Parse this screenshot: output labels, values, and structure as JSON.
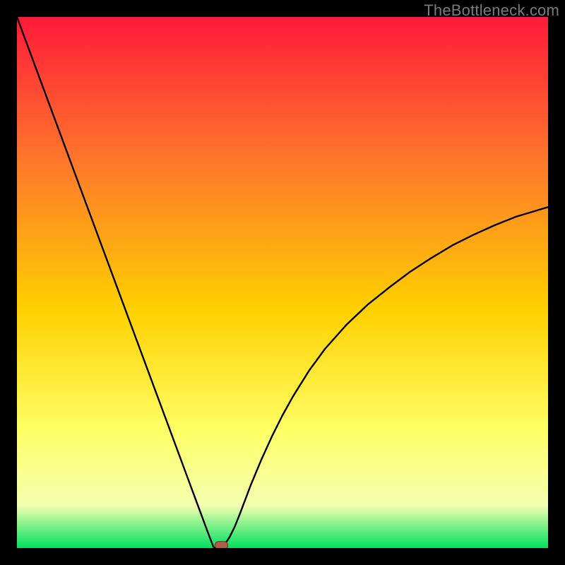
{
  "attribution": "TheBottleneck.com",
  "colors": {
    "background": "#000000",
    "gradient_top": "#ff1a3a",
    "gradient_upper_mid": "#ff7a2a",
    "gradient_mid": "#ffd000",
    "gradient_lower_mid": "#ffff66",
    "gradient_low": "#f3ffb0",
    "gradient_bottom": "#00e060",
    "curve": "#000000",
    "dot_fill": "#b35a4a",
    "dot_stroke": "#6e2f23"
  },
  "chart_data": {
    "type": "line",
    "title": "",
    "xlabel": "",
    "ylabel": "",
    "xlim": [
      0,
      100
    ],
    "ylim": [
      0,
      100
    ],
    "x": [
      0,
      2,
      4,
      6,
      8,
      10,
      12,
      14,
      16,
      18,
      20,
      22,
      24,
      26,
      28,
      30,
      32,
      34,
      36,
      37,
      38,
      39,
      40,
      41,
      42,
      44,
      46,
      48,
      50,
      52,
      55,
      58,
      62,
      66,
      70,
      74,
      78,
      82,
      86,
      90,
      94,
      98,
      100
    ],
    "values": [
      100,
      94.6,
      89.2,
      83.8,
      78.4,
      73.0,
      67.6,
      62.2,
      56.8,
      51.4,
      46.0,
      40.6,
      35.2,
      29.8,
      24.4,
      19.0,
      13.6,
      8.2,
      2.8,
      0.2,
      0.0,
      0.5,
      2.0,
      4.0,
      6.5,
      11.8,
      16.6,
      21.0,
      25.0,
      28.6,
      33.4,
      37.5,
      42.0,
      45.8,
      49.0,
      52.0,
      54.6,
      57.0,
      59.0,
      60.8,
      62.4,
      63.6,
      64.2
    ],
    "marker": {
      "x": 38.5,
      "y": 0.5
    },
    "legend": [],
    "grid": false
  }
}
